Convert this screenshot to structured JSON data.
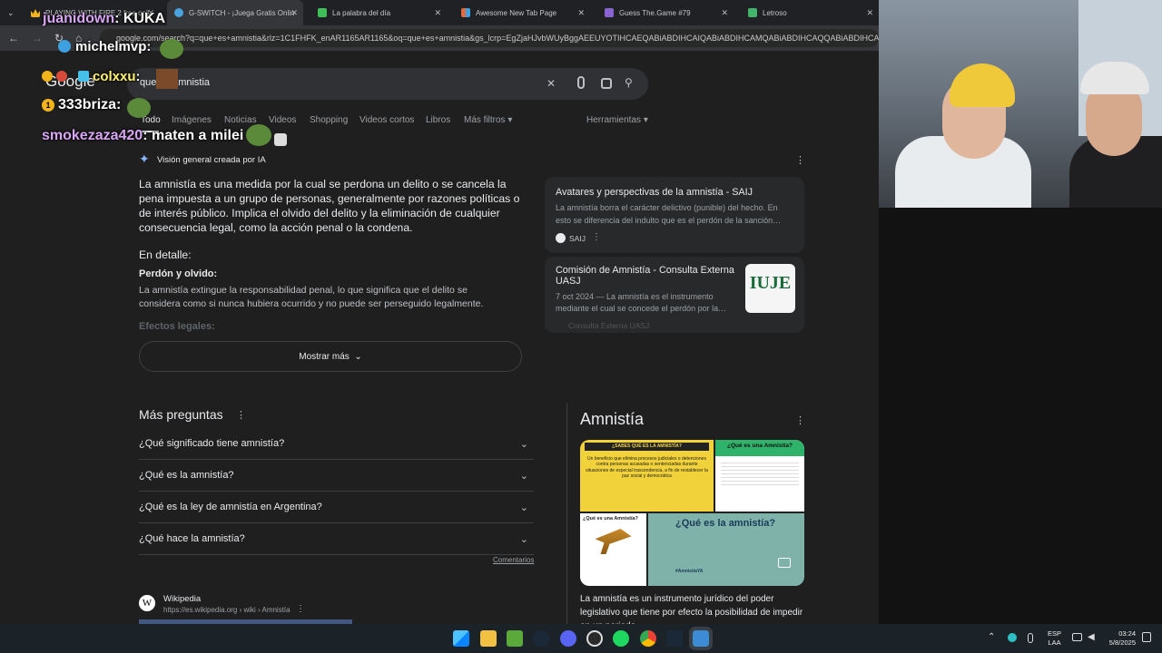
{
  "tabs": [
    {
      "title": "PLAYING WITH FIRE 2 free onli",
      "icon": "crown-icon",
      "color": "#f2b31b"
    },
    {
      "title": "G-SWITCH - ¡Juega Gratis Onlin",
      "icon": "circle-icon",
      "color": "#4aa3df"
    },
    {
      "title": "La palabra del día",
      "icon": "p-icon",
      "color": "#3fbf57"
    },
    {
      "title": "Awesome New Tab Page",
      "icon": "grid-icon",
      "color": "#e06b3f"
    },
    {
      "title": "Guess The.Game #79",
      "icon": "gamepad-icon",
      "color": "#8a63d2"
    },
    {
      "title": "Letroso",
      "icon": "grid-icon",
      "color": "#41b36b"
    }
  ],
  "url": "google.com/search?q=que+es+amnistia&rlz=1C1FHFK_enAR1165AR1165&oq=que+es+amnistia&gs_lcrp=EgZjaHJvbWUyBggAEEUYOTIHCAEQABiABDIHCAIQABiABDIHCAMQABiABDIHCAQQABiABDIHCA",
  "logo": "Google",
  "search_query": "que es amnistia",
  "search_tabs": [
    "Todo",
    "Imágenes",
    "Noticias",
    "Videos",
    "Shopping",
    "Videos cortos",
    "Libros",
    "Más filtros",
    "Herramientas"
  ],
  "chat": [
    {
      "user": "juanidown",
      "text": ": KUKA"
    },
    {
      "user": "michelmvp",
      "text": ":"
    },
    {
      "user": "colxxu",
      "text": ":"
    },
    {
      "user": "333briza",
      "text": ":"
    },
    {
      "user": "smokezaza420",
      "text": ": maten a milei"
    }
  ],
  "ai": {
    "header": "Visión general creada por IA",
    "paragraph": "La amnistía es una medida por la cual se perdona un delito o se cancela la pena impuesta a un grupo de personas, generalmente por razones políticas o de interés público. Implica el olvido del delito y la eliminación de cualquier consecuencia legal, como la acción penal o la condena.",
    "detail_heading": "En detalle:",
    "sub1_title": "Perdón y olvido:",
    "sub1_text": "La amnistía extingue la responsabilidad penal, lo que significa que el delito se considera como si nunca hubiera ocurrido y no puede ser perseguido legalmente.",
    "sub2_title": "Efectos legales:",
    "show_more": "Mostrar más",
    "sources": [
      {
        "title": "Avatares y perspectivas de la amnistía - SAIJ",
        "snippet": "La amnistía borra el carácter delictivo (punible) del hecho. En esto se diferencia del indulto que es el perdón de la sanción…",
        "site": "SAIJ"
      },
      {
        "title": "Comisión de Amnistía - Consulta Externa UASJ",
        "snippet": "7 oct 2024 — La amnistía es el instrumento mediante el cual se concede el perdón por la…",
        "site": "Consulta Externa UASJ",
        "thumb_text": "IUJE"
      }
    ]
  },
  "more_questions": {
    "title": "Más preguntas",
    "items": [
      "¿Qué significado tiene amnistía?",
      "¿Qué es la amnistía?",
      "¿Qué es la ley de amnistía en Argentina?",
      "¿Qué hace la amnistía?"
    ],
    "feedback": "Comentarios"
  },
  "result": {
    "site": "Wikipedia",
    "url": "https://es.wikipedia.org › wiki › Amnistía"
  },
  "knowledge": {
    "title": "Amnistía",
    "description": "La amnistía es un instrumento jurídico del poder legislativo que tiene por efecto la posibilidad de impedir en un periodo",
    "img1_head": "¿SABES QUÉ ES LA AMNISTÍA?",
    "img1_text": "Un beneficio que elimina procesos judiciales o detenciones contra personas acusadas o sentenciadas durante situaciones de especial trascendencia, a fin de restablecer la paz social y democrática",
    "img2_head": "¿Qué es una Amnistía?",
    "img3_head": "¿Qué es una Amnistía?",
    "img4_head": "¿Qué es la amnistía?",
    "img4_tag": "#AmnistíaYA"
  },
  "taskbar": {
    "lang": "ESP",
    "layout": "LAA",
    "time": "03:24",
    "date": "5/8/2025"
  }
}
